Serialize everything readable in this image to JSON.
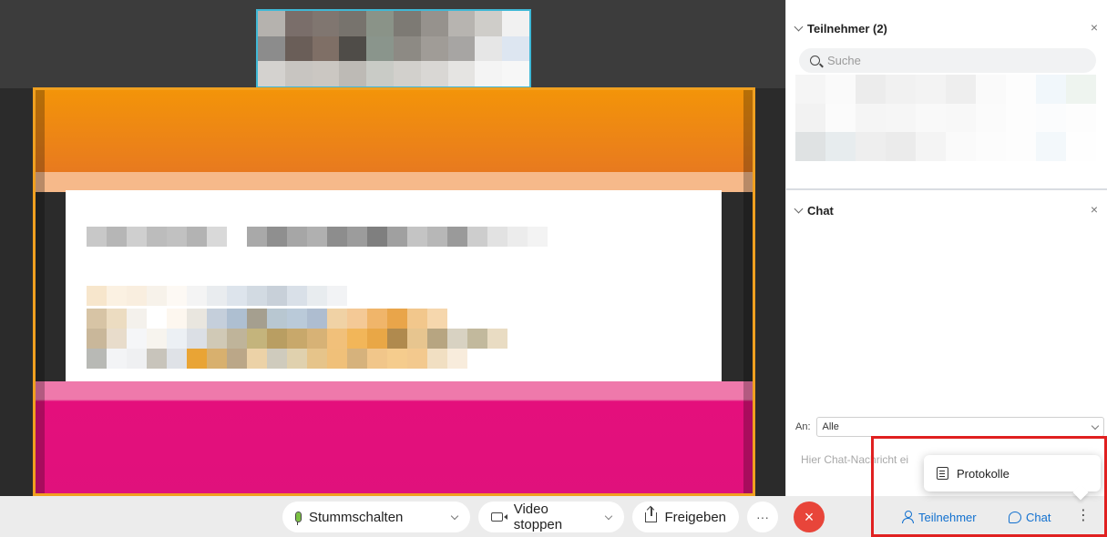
{
  "participants_panel": {
    "title": "Teilnehmer (2)",
    "close": "×",
    "search_placeholder": "Suche"
  },
  "chat_panel": {
    "title": "Chat",
    "close": "×",
    "to_label": "An:",
    "to_value": "Alle",
    "message_placeholder": "Hier Chat-Nachricht ei"
  },
  "controls": {
    "mute_label": "Stummschalten",
    "video_label": "Video stoppen",
    "share_label": "Freigeben",
    "more_label": "···",
    "end_label": "×",
    "participants_label": "Teilnehmer",
    "chat_label": "Chat",
    "kebab_label": "⋮"
  },
  "popup_menu": {
    "items": [
      {
        "label": "Protokolle",
        "icon": "document-icon"
      }
    ]
  },
  "colors": {
    "accent_blue": "#1170cf",
    "end_call_red": "#e8453a",
    "highlight_red": "#e02020",
    "share_orange": "#f39409",
    "share_magenta": "#e0117c"
  }
}
